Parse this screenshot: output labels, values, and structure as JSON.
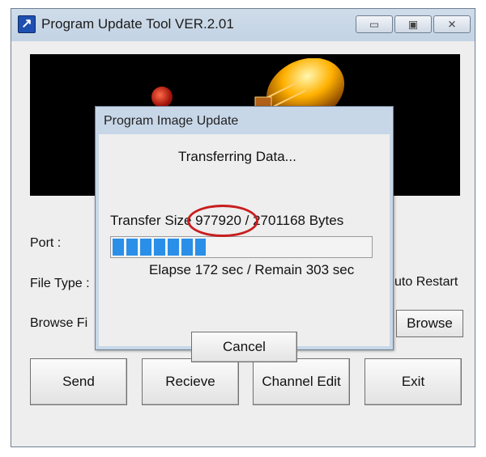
{
  "window": {
    "title": "Program Update Tool VER.2.01",
    "icons": [
      "app-icon",
      "minimize-icon",
      "maximize-icon",
      "close-icon"
    ]
  },
  "main": {
    "port_label": "Port :",
    "file_type_label": "File Type :",
    "browse_file_label": "Browse Fi",
    "auto_restart_label": "uto Restart",
    "browse_button": "Browse",
    "buttons": {
      "send": "Send",
      "receive": "Recieve",
      "channel_edit": "Channel Edit",
      "exit": "Exit"
    }
  },
  "dialog": {
    "title": "Program Image Update",
    "status": "Transferring Data...",
    "transfer_text": "Transfer Size 977920 / 2701168 Bytes",
    "transferred_bytes": 977920,
    "total_bytes": 2701168,
    "progress_fraction": 0.362,
    "elapse_text": "Elapse 172 sec / Remain 303 sec",
    "cancel_button": "Cancel"
  },
  "colors": {
    "progress": "#2a8fe8",
    "annotation": "#c81e1e",
    "titlebar": "#c3d3e4"
  }
}
